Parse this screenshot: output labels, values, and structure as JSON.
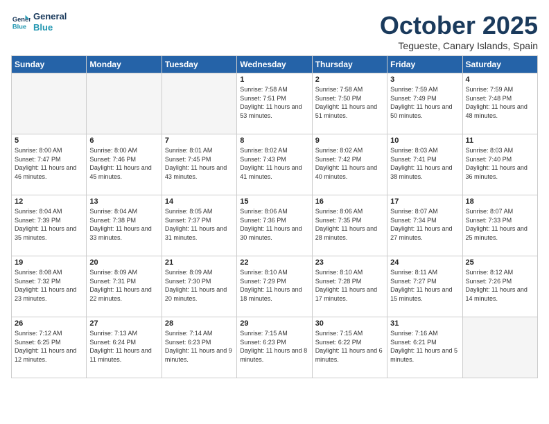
{
  "header": {
    "logo_general": "General",
    "logo_blue": "Blue",
    "month": "October 2025",
    "location": "Tegueste, Canary Islands, Spain"
  },
  "weekdays": [
    "Sunday",
    "Monday",
    "Tuesday",
    "Wednesday",
    "Thursday",
    "Friday",
    "Saturday"
  ],
  "weeks": [
    [
      {
        "day": "",
        "sunrise": "",
        "sunset": "",
        "daylight": "",
        "empty": true
      },
      {
        "day": "",
        "sunrise": "",
        "sunset": "",
        "daylight": "",
        "empty": true
      },
      {
        "day": "",
        "sunrise": "",
        "sunset": "",
        "daylight": "",
        "empty": true
      },
      {
        "day": "1",
        "sunrise": "Sunrise: 7:58 AM",
        "sunset": "Sunset: 7:51 PM",
        "daylight": "Daylight: 11 hours and 53 minutes.",
        "empty": false
      },
      {
        "day": "2",
        "sunrise": "Sunrise: 7:58 AM",
        "sunset": "Sunset: 7:50 PM",
        "daylight": "Daylight: 11 hours and 51 minutes.",
        "empty": false
      },
      {
        "day": "3",
        "sunrise": "Sunrise: 7:59 AM",
        "sunset": "Sunset: 7:49 PM",
        "daylight": "Daylight: 11 hours and 50 minutes.",
        "empty": false
      },
      {
        "day": "4",
        "sunrise": "Sunrise: 7:59 AM",
        "sunset": "Sunset: 7:48 PM",
        "daylight": "Daylight: 11 hours and 48 minutes.",
        "empty": false
      }
    ],
    [
      {
        "day": "5",
        "sunrise": "Sunrise: 8:00 AM",
        "sunset": "Sunset: 7:47 PM",
        "daylight": "Daylight: 11 hours and 46 minutes.",
        "empty": false
      },
      {
        "day": "6",
        "sunrise": "Sunrise: 8:00 AM",
        "sunset": "Sunset: 7:46 PM",
        "daylight": "Daylight: 11 hours and 45 minutes.",
        "empty": false
      },
      {
        "day": "7",
        "sunrise": "Sunrise: 8:01 AM",
        "sunset": "Sunset: 7:45 PM",
        "daylight": "Daylight: 11 hours and 43 minutes.",
        "empty": false
      },
      {
        "day": "8",
        "sunrise": "Sunrise: 8:02 AM",
        "sunset": "Sunset: 7:43 PM",
        "daylight": "Daylight: 11 hours and 41 minutes.",
        "empty": false
      },
      {
        "day": "9",
        "sunrise": "Sunrise: 8:02 AM",
        "sunset": "Sunset: 7:42 PM",
        "daylight": "Daylight: 11 hours and 40 minutes.",
        "empty": false
      },
      {
        "day": "10",
        "sunrise": "Sunrise: 8:03 AM",
        "sunset": "Sunset: 7:41 PM",
        "daylight": "Daylight: 11 hours and 38 minutes.",
        "empty": false
      },
      {
        "day": "11",
        "sunrise": "Sunrise: 8:03 AM",
        "sunset": "Sunset: 7:40 PM",
        "daylight": "Daylight: 11 hours and 36 minutes.",
        "empty": false
      }
    ],
    [
      {
        "day": "12",
        "sunrise": "Sunrise: 8:04 AM",
        "sunset": "Sunset: 7:39 PM",
        "daylight": "Daylight: 11 hours and 35 minutes.",
        "empty": false
      },
      {
        "day": "13",
        "sunrise": "Sunrise: 8:04 AM",
        "sunset": "Sunset: 7:38 PM",
        "daylight": "Daylight: 11 hours and 33 minutes.",
        "empty": false
      },
      {
        "day": "14",
        "sunrise": "Sunrise: 8:05 AM",
        "sunset": "Sunset: 7:37 PM",
        "daylight": "Daylight: 11 hours and 31 minutes.",
        "empty": false
      },
      {
        "day": "15",
        "sunrise": "Sunrise: 8:06 AM",
        "sunset": "Sunset: 7:36 PM",
        "daylight": "Daylight: 11 hours and 30 minutes.",
        "empty": false
      },
      {
        "day": "16",
        "sunrise": "Sunrise: 8:06 AM",
        "sunset": "Sunset: 7:35 PM",
        "daylight": "Daylight: 11 hours and 28 minutes.",
        "empty": false
      },
      {
        "day": "17",
        "sunrise": "Sunrise: 8:07 AM",
        "sunset": "Sunset: 7:34 PM",
        "daylight": "Daylight: 11 hours and 27 minutes.",
        "empty": false
      },
      {
        "day": "18",
        "sunrise": "Sunrise: 8:07 AM",
        "sunset": "Sunset: 7:33 PM",
        "daylight": "Daylight: 11 hours and 25 minutes.",
        "empty": false
      }
    ],
    [
      {
        "day": "19",
        "sunrise": "Sunrise: 8:08 AM",
        "sunset": "Sunset: 7:32 PM",
        "daylight": "Daylight: 11 hours and 23 minutes.",
        "empty": false
      },
      {
        "day": "20",
        "sunrise": "Sunrise: 8:09 AM",
        "sunset": "Sunset: 7:31 PM",
        "daylight": "Daylight: 11 hours and 22 minutes.",
        "empty": false
      },
      {
        "day": "21",
        "sunrise": "Sunrise: 8:09 AM",
        "sunset": "Sunset: 7:30 PM",
        "daylight": "Daylight: 11 hours and 20 minutes.",
        "empty": false
      },
      {
        "day": "22",
        "sunrise": "Sunrise: 8:10 AM",
        "sunset": "Sunset: 7:29 PM",
        "daylight": "Daylight: 11 hours and 18 minutes.",
        "empty": false
      },
      {
        "day": "23",
        "sunrise": "Sunrise: 8:10 AM",
        "sunset": "Sunset: 7:28 PM",
        "daylight": "Daylight: 11 hours and 17 minutes.",
        "empty": false
      },
      {
        "day": "24",
        "sunrise": "Sunrise: 8:11 AM",
        "sunset": "Sunset: 7:27 PM",
        "daylight": "Daylight: 11 hours and 15 minutes.",
        "empty": false
      },
      {
        "day": "25",
        "sunrise": "Sunrise: 8:12 AM",
        "sunset": "Sunset: 7:26 PM",
        "daylight": "Daylight: 11 hours and 14 minutes.",
        "empty": false
      }
    ],
    [
      {
        "day": "26",
        "sunrise": "Sunrise: 7:12 AM",
        "sunset": "Sunset: 6:25 PM",
        "daylight": "Daylight: 11 hours and 12 minutes.",
        "empty": false
      },
      {
        "day": "27",
        "sunrise": "Sunrise: 7:13 AM",
        "sunset": "Sunset: 6:24 PM",
        "daylight": "Daylight: 11 hours and 11 minutes.",
        "empty": false
      },
      {
        "day": "28",
        "sunrise": "Sunrise: 7:14 AM",
        "sunset": "Sunset: 6:23 PM",
        "daylight": "Daylight: 11 hours and 9 minutes.",
        "empty": false
      },
      {
        "day": "29",
        "sunrise": "Sunrise: 7:15 AM",
        "sunset": "Sunset: 6:23 PM",
        "daylight": "Daylight: 11 hours and 8 minutes.",
        "empty": false
      },
      {
        "day": "30",
        "sunrise": "Sunrise: 7:15 AM",
        "sunset": "Sunset: 6:22 PM",
        "daylight": "Daylight: 11 hours and 6 minutes.",
        "empty": false
      },
      {
        "day": "31",
        "sunrise": "Sunrise: 7:16 AM",
        "sunset": "Sunset: 6:21 PM",
        "daylight": "Daylight: 11 hours and 5 minutes.",
        "empty": false
      },
      {
        "day": "",
        "sunrise": "",
        "sunset": "",
        "daylight": "",
        "empty": true
      }
    ]
  ]
}
